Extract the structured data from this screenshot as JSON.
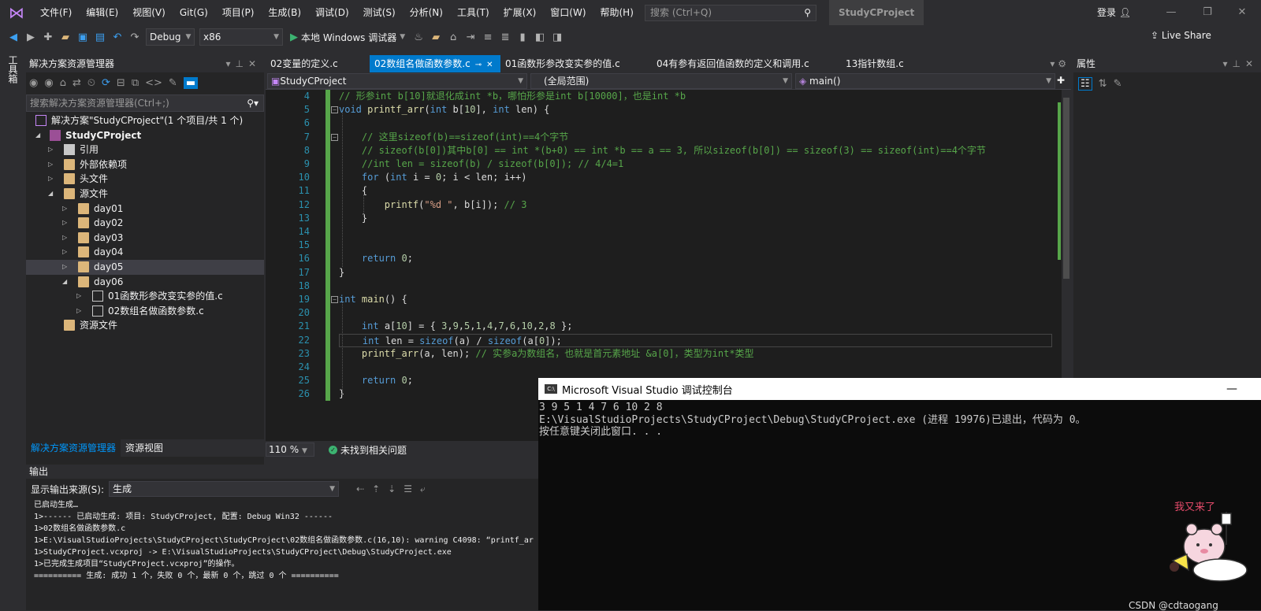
{
  "menu": [
    "文件(F)",
    "编辑(E)",
    "视图(V)",
    "Git(G)",
    "项目(P)",
    "生成(B)",
    "调试(D)",
    "测试(S)",
    "分析(N)",
    "工具(T)",
    "扩展(X)",
    "窗口(W)",
    "帮助(H)"
  ],
  "search": {
    "placeholder": "搜索 (Ctrl+Q)"
  },
  "project_title": "StudyCProject",
  "login": "登录",
  "toolbar": {
    "config": "Debug",
    "platform": "x86",
    "run_label": "本地 Windows 调试器",
    "live_share": "Live Share"
  },
  "left_toolbox_label": "工具箱",
  "solution_explorer": {
    "title": "解决方案资源管理器",
    "search_placeholder": "搜索解决方案资源管理器(Ctrl+;)",
    "items": [
      {
        "label": "解决方案\"StudyCProject\"(1 个项目/共 1 个)"
      },
      {
        "label": "StudyCProject"
      },
      {
        "label": "引用"
      },
      {
        "label": "外部依赖项"
      },
      {
        "label": "头文件"
      },
      {
        "label": "源文件"
      },
      {
        "label": "day01"
      },
      {
        "label": "day02"
      },
      {
        "label": "day03"
      },
      {
        "label": "day04"
      },
      {
        "label": "day05"
      },
      {
        "label": "day06"
      },
      {
        "label": "01函数形参改变实参的值.c"
      },
      {
        "label": "02数组名做函数参数.c"
      },
      {
        "label": "资源文件"
      }
    ],
    "bottom_tabs": [
      "解决方案资源管理器",
      "资源视图"
    ]
  },
  "editor": {
    "tabs": [
      "02变量的定义.c",
      "02数组名做函数参数.c",
      "01函数形参改变实参的值.c",
      "04有参有返回值函数的定义和调用.c",
      "13指针数组.c"
    ],
    "nav": {
      "project": "StudyCProject",
      "scope": "(全局范围)",
      "member": "main()"
    },
    "line_numbers": [
      "4",
      "5",
      "6",
      "7",
      "8",
      "9",
      "10",
      "11",
      "12",
      "13",
      "14",
      "15",
      "16",
      "17",
      "18",
      "19",
      "20",
      "21",
      "22",
      "23",
      "24",
      "25",
      "26"
    ],
    "zoom": "110 %",
    "status": "未找到相关问题"
  },
  "properties": {
    "title": "属性"
  },
  "output": {
    "title": "输出",
    "source_label": "显示输出来源(S):",
    "source_value": "生成",
    "lines": [
      "已启动生成…",
      "1>------ 已启动生成: 项目: StudyCProject, 配置: Debug Win32 ------",
      "1>02数组名做函数参数.c",
      "1>E:\\VisualStudioProjects\\StudyCProject\\StudyCProject\\02数组名做函数参数.c(16,10): warning C4098: “printf_ar",
      "1>StudyCProject.vcxproj -> E:\\VisualStudioProjects\\StudyCProject\\Debug\\StudyCProject.exe",
      "1>已完成生成项目“StudyCProject.vcxproj”的操作。",
      "========== 生成: 成功 1 个，失败 0 个，最新 0 个，跳过 0 个 =========="
    ]
  },
  "console": {
    "title": "Microsoft Visual Studio 调试控制台",
    "lines": [
      "3 9 5 1 4 7 6 10 2 8",
      "E:\\VisualStudioProjects\\StudyCProject\\Debug\\StudyCProject.exe (进程 19976)已退出，代码为 0。",
      "按任意键关闭此窗口. . ."
    ]
  },
  "mascot_text": "我又来了",
  "watermark": "CSDN @cdtaogang"
}
